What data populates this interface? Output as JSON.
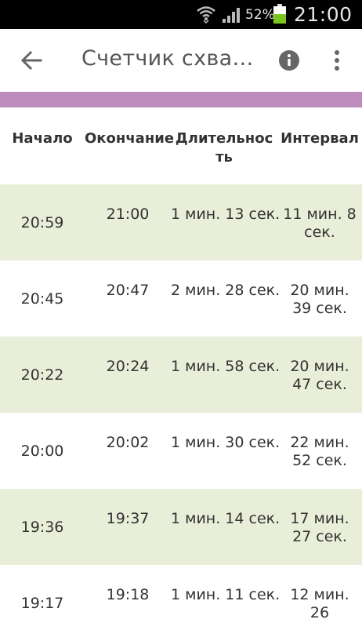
{
  "status_bar": {
    "battery_percent": "52%",
    "time": "21:00",
    "wifi_icon": "wifi-icon",
    "signal_icon": "signal-icon",
    "battery_icon": "battery-icon",
    "battery_color": "#7cc520"
  },
  "app_bar": {
    "title": "Счетчик схват...",
    "back_icon": "arrow-back-icon",
    "info_icon": "info-icon",
    "more_icon": "more-vert-icon"
  },
  "colors": {
    "accent_strip": "#bd8cbd",
    "row_highlight": "#e8eed7"
  },
  "table": {
    "headers": {
      "start": "Начало",
      "end": "Окончание",
      "duration": "Длительность",
      "interval": "Интервал"
    },
    "rows": [
      {
        "start": "20:59",
        "end": "21:00",
        "duration": "1 мин. 13 сек.",
        "interval": "11 мин. 8 сек."
      },
      {
        "start": "20:45",
        "end": "20:47",
        "duration": "2 мин. 28 сек.",
        "interval": "20 мин. 39 сек."
      },
      {
        "start": "20:22",
        "end": "20:24",
        "duration": "1 мин. 58 сек.",
        "interval": "20 мин. 47 сек."
      },
      {
        "start": "20:00",
        "end": "20:02",
        "duration": "1 мин. 30 сек.",
        "interval": "22 мин. 52 сек."
      },
      {
        "start": "19:36",
        "end": "19:37",
        "duration": "1 мин. 14 сек.",
        "interval": "17 мин. 27 сек."
      },
      {
        "start": "19:17",
        "end": "19:18",
        "duration": "1 мин. 11 сек.",
        "interval": "12 мин. 26"
      }
    ]
  }
}
